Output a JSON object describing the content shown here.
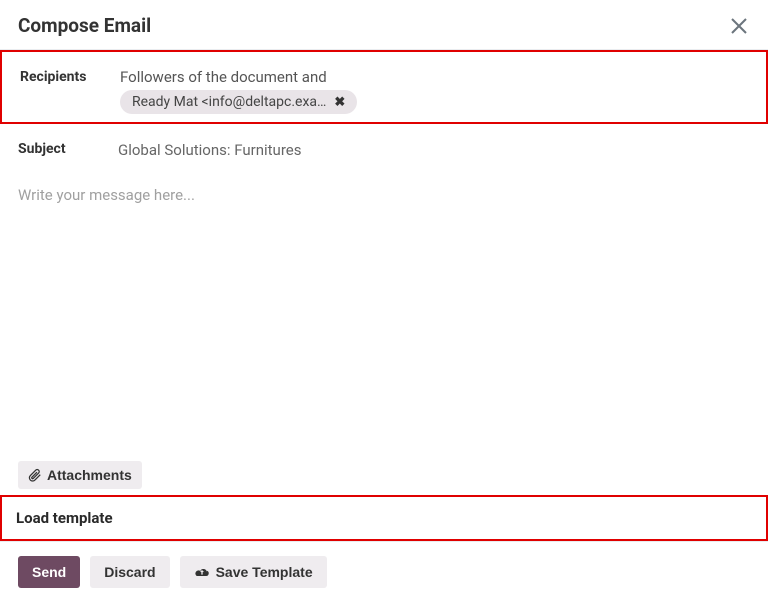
{
  "header": {
    "title": "Compose Email"
  },
  "recipients": {
    "label": "Recipients",
    "followers_text": "Followers of the document and",
    "chips": [
      {
        "display": "Ready Mat <info@deltapc.exa…"
      }
    ]
  },
  "subject": {
    "label": "Subject",
    "value": "Global Solutions: Furnitures"
  },
  "editor": {
    "placeholder": "Write your message here..."
  },
  "attachments": {
    "label": "Attachments"
  },
  "load_template": {
    "label": "Load template"
  },
  "footer": {
    "send": "Send",
    "discard": "Discard",
    "save_template": "Save Template"
  }
}
